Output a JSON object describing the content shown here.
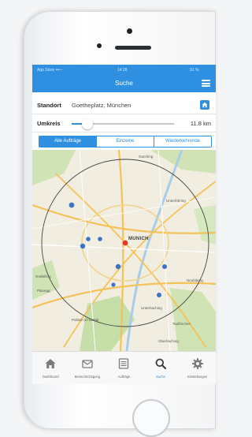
{
  "status_bar": {
    "carrier": "App Store •••◦◦",
    "time": "14:28",
    "battery": "91 %"
  },
  "navbar": {
    "title": "Suche"
  },
  "standort": {
    "label": "Standort",
    "value": "Goetheplatz, München"
  },
  "umkreis": {
    "label": "Umkreis",
    "value_text": "11.8 km",
    "slider_fraction": 0.1
  },
  "filter_tabs": [
    {
      "label": "Alle Aufträge",
      "active": true
    },
    {
      "label": "Einzelne",
      "active": false
    },
    {
      "label": "Wiederkehrende",
      "active": false
    }
  ],
  "map": {
    "city": "MUNICH",
    "places": [
      "Garching",
      "Unterföhring",
      "Gräfelfing",
      "Planegg",
      "Pullach im Isartal",
      "Unterhaching",
      "Taufkirchen",
      "Oberhaching",
      "Neubiberg"
    ],
    "pin_color": "#e8352b",
    "marker_color": "#3b74c4"
  },
  "tabs": [
    {
      "label": "Dashboard",
      "icon": "home-icon",
      "active": false
    },
    {
      "label": "Benachrichtigung",
      "icon": "envelope-icon",
      "active": false
    },
    {
      "label": "Aufträge",
      "icon": "list-icon",
      "active": false
    },
    {
      "label": "Suche",
      "icon": "search-icon",
      "active": true
    },
    {
      "label": "Einstellungen",
      "icon": "gear-icon",
      "active": false
    }
  ],
  "colors": {
    "accent": "#2f8fe0"
  }
}
